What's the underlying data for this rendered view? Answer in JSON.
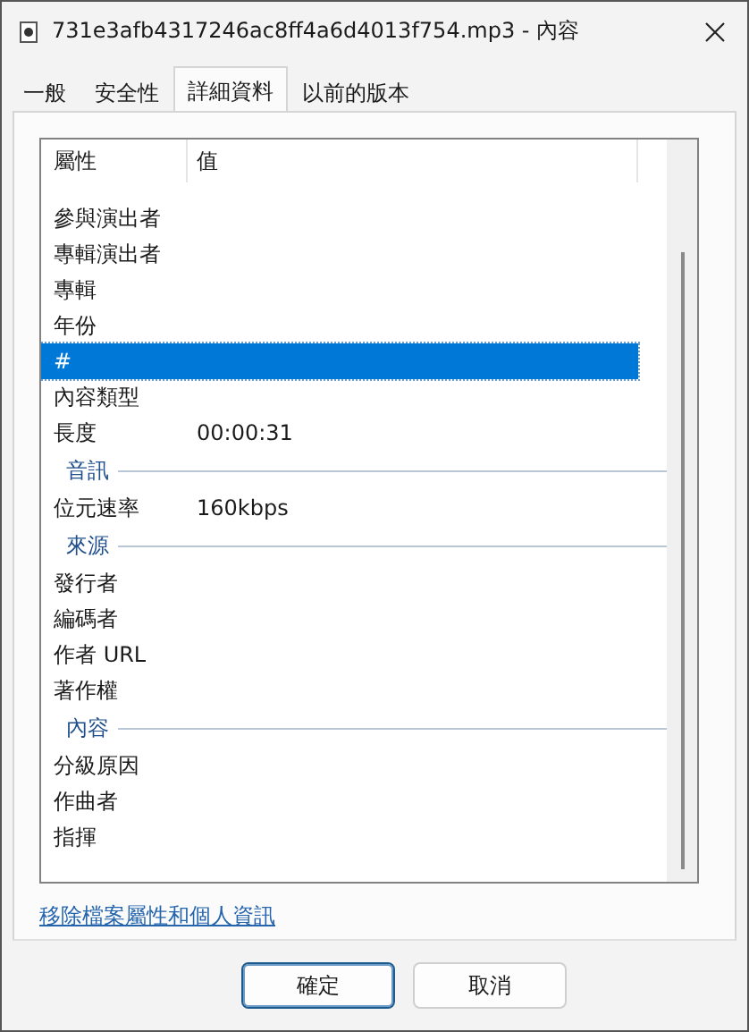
{
  "window": {
    "title": "731e3afb4317246ac8ff4a6d4013f754.mp3 - 內容"
  },
  "tabs": [
    {
      "label": "一般",
      "selected": false
    },
    {
      "label": "安全性",
      "selected": false
    },
    {
      "label": "詳細資料",
      "selected": true
    },
    {
      "label": "以前的版本",
      "selected": false
    }
  ],
  "table": {
    "columns": [
      "屬性",
      "值"
    ],
    "rows": [
      {
        "kind": "property",
        "name": "參與演出者",
        "selected": false
      },
      {
        "kind": "property",
        "name": "專輯演出者",
        "selected": false
      },
      {
        "kind": "property",
        "name": "專輯",
        "selected": false
      },
      {
        "kind": "property",
        "name": "年份",
        "selected": false
      },
      {
        "kind": "property",
        "name": "#",
        "selected": true
      },
      {
        "kind": "property",
        "name": "內容類型",
        "selected": false
      },
      {
        "kind": "property",
        "name": "長度",
        "value": "00:00:31",
        "selected": false
      },
      {
        "kind": "group",
        "name": "音訊"
      },
      {
        "kind": "property",
        "name": "位元速率",
        "value": "160kbps",
        "selected": false
      },
      {
        "kind": "group",
        "name": "來源"
      },
      {
        "kind": "property",
        "name": "發行者",
        "selected": false
      },
      {
        "kind": "property",
        "name": "編碼者",
        "selected": false
      },
      {
        "kind": "property",
        "name": "作者 URL",
        "selected": false
      },
      {
        "kind": "property",
        "name": "著作權",
        "selected": false
      },
      {
        "kind": "group",
        "name": "內容"
      },
      {
        "kind": "property",
        "name": "分級原因",
        "selected": false
      },
      {
        "kind": "property",
        "name": "作曲者",
        "selected": false
      },
      {
        "kind": "property",
        "name": "指揮",
        "selected": false
      }
    ]
  },
  "link": "移除檔案屬性和個人資訊",
  "buttons": [
    {
      "label": "確定",
      "default": true
    },
    {
      "label": "取消",
      "default": false
    }
  ]
}
